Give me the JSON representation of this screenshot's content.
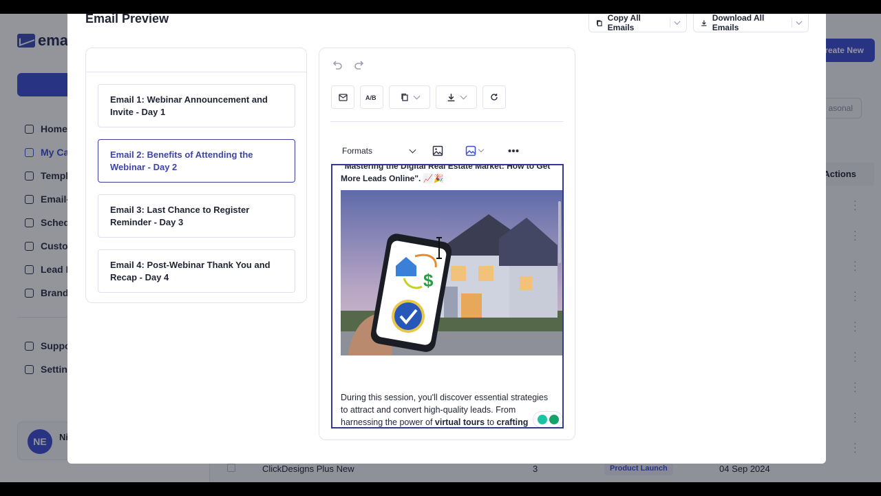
{
  "app": {
    "logo_text": "ema",
    "nav": [
      {
        "label": "Home",
        "icon": "home-icon"
      },
      {
        "label": "My Ca",
        "icon": "document-icon",
        "active": true
      },
      {
        "label": "Templ",
        "icon": "template-icon"
      },
      {
        "label": "Email-",
        "icon": "pen-icon"
      },
      {
        "label": "Sched",
        "icon": "mail-icon"
      },
      {
        "label": "Custo",
        "icon": "mail-icon"
      },
      {
        "label": "Lead F",
        "icon": "search-icon"
      },
      {
        "label": "Brand",
        "icon": "tag-icon"
      }
    ],
    "nav_secondary": [
      {
        "label": "Suppo",
        "icon": "headset-icon"
      },
      {
        "label": "Settin",
        "icon": "gear-icon"
      }
    ],
    "user": {
      "initials": "NE",
      "name": "Ni"
    },
    "create_new_label": "reate New",
    "filter_label": "asonal",
    "actions_header": "Actions",
    "bottom_row": {
      "name": "ClickDesigns Plus New",
      "count": "3",
      "badge": "Product Launch",
      "date": "04 Sep 2024"
    }
  },
  "modal": {
    "title": "Email Preview",
    "copy_all_label": "Copy All Emails",
    "download_all_label": "Download All Emails",
    "emails": [
      {
        "label": "Email 1: Webinar Announcement and Invite - Day 1",
        "active": false
      },
      {
        "label": "Email 2: Benefits of Attending the Webinar - Day 2",
        "active": true
      },
      {
        "label": "Email 3: Last Chance to Register Reminder - Day 3",
        "active": false
      },
      {
        "label": "Email 4: Post-Webinar Thank You and Recap - Day 4",
        "active": false
      }
    ],
    "editor": {
      "formats_label": "Formats",
      "lead_line1": "\"Mastering the Digital Real Estate Market: How to Get",
      "lead_line2": "More Leads Online\". 📈🎉",
      "body_text_1": "During this session, you'll discover essential strategies to attract and convert high-quality leads. From harnessing the power of ",
      "body_bold_1": "virtual tours",
      "body_text_2": " to ",
      "body_bold_2": "crafting"
    }
  }
}
